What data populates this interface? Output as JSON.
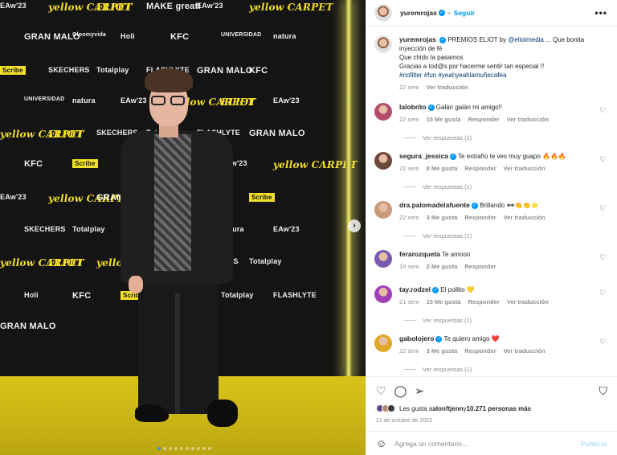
{
  "post": {
    "username": "yuremrojas",
    "follow_label": "Seguir",
    "more_label": "•••",
    "caption": {
      "username": "yuremrojas",
      "text_1": "PREMIOS ELIOT by ",
      "mention": "@eliotmedia",
      "text_2": " ... Que bonita inyección de fé",
      "line_2": "Que chido la pasamos",
      "line_3": "Gracias a tod@s por hacerme sentir tan especial !!",
      "hashtags": "#nofilter #fun #yeahyeahlamuñecafea",
      "time": "22 sem",
      "translate": "Ver traducción"
    }
  },
  "comments": [
    {
      "user": "lalobrito",
      "verified": true,
      "text": "Galán galán mi amigo!!",
      "time": "22 sem",
      "likes": "15 Me gusta",
      "reply": "Responder",
      "translate": "Ver traducción",
      "replies": "Ver respuestas (1)",
      "avatar_color": "#b34d6e"
    },
    {
      "user": "segura_jessica",
      "verified": true,
      "text": "Te extraño te ves muy guapo 🔥🔥🔥",
      "time": "22 sem",
      "likes": "8 Me gusta",
      "reply": "Responder",
      "translate": "Ver traducción",
      "replies": "Ver respuestas (1)",
      "avatar_color": "#6d4a3a"
    },
    {
      "user": "dra.palomadelafuente",
      "verified": true,
      "text": "Brillando 🕶👏👏⭐",
      "time": "22 sem",
      "likes": "3 Me gusta",
      "reply": "Responder",
      "translate": "Ver traducción",
      "replies": "Ver respuestas (1)",
      "avatar_color": "#c99a7a"
    },
    {
      "user": "ferarozqueta",
      "verified": false,
      "text": "Te amooo",
      "time": "19 sem",
      "likes": "2 Me gusta",
      "reply": "Responder",
      "translate": "",
      "replies": "",
      "avatar_color": "#7a5bb0"
    },
    {
      "user": "tay.rodzel",
      "verified": true,
      "text": "El pollito 💛",
      "time": "21 sem",
      "likes": "10 Me gusta",
      "reply": "Responder",
      "translate": "Ver traducción",
      "replies": "Ver respuestas (1)",
      "avatar_color": "#a33fb8"
    },
    {
      "user": "gabolojero",
      "verified": true,
      "text": "Te quiero amigo ❤️",
      "time": "22 sem",
      "likes": "3 Me gusta",
      "reply": "Responder",
      "translate": "Ver traducción",
      "replies": "Ver respuestas (1)",
      "avatar_color": "#e1a92a"
    }
  ],
  "actions": {
    "likes_prefix": "Les gusta a ",
    "likes_user": "alonftjenn",
    "likes_mid": " y ",
    "likes_count": "10.271 personas más",
    "date": "21 de octubre de 2023"
  },
  "add_comment": {
    "placeholder": "Agrega un comentario...",
    "post_label": "Publicar"
  },
  "photo": {
    "logos": [
      "EAw'23",
      "yellow CARPET",
      "ELIOT",
      "MAKE great!",
      "EAw'23",
      "yellow CARPET",
      "GRAN MALO",
      "Gloomyvida",
      "Holi",
      "KFC",
      "UNIVERSIDAD",
      "natura",
      "Scribe",
      "SKECHERS",
      "Totalplay",
      "FLASHLYTE",
      "GRAN MALO",
      "KFC",
      "UNIVERSIDAD",
      "natura",
      "EAw'23",
      "yellow CARPET",
      "ELIOT",
      "EAw'23",
      "yellow CARPET",
      "ELIOT",
      "SKECHERS",
      "Totalplay",
      "FLASHLYTE",
      "GRAN MALO",
      "KFC",
      "Scribe",
      "SKECHERS",
      "MAKE great!",
      "EAw'23",
      "yellow CARPET",
      "EAw'23",
      "yellow CARPET",
      "GRAN MALO",
      "Holi",
      "KFC",
      "Scribe",
      "SKECHERS",
      "Totalplay",
      "FLASHLYTE",
      "GRAN MALO",
      "natura",
      "EAw'23",
      "yellow CARPET",
      "ELIOT",
      "yellow CARPET",
      "ELIOT",
      "SKECHERS",
      "Totalplay",
      "Holi",
      "KFC",
      "Scribe",
      "SKECHERS",
      "Totalplay",
      "FLASHLYTE",
      "GRAN MALO"
    ],
    "next_label": "›",
    "slide_count": 10,
    "active_slide": 1
  }
}
